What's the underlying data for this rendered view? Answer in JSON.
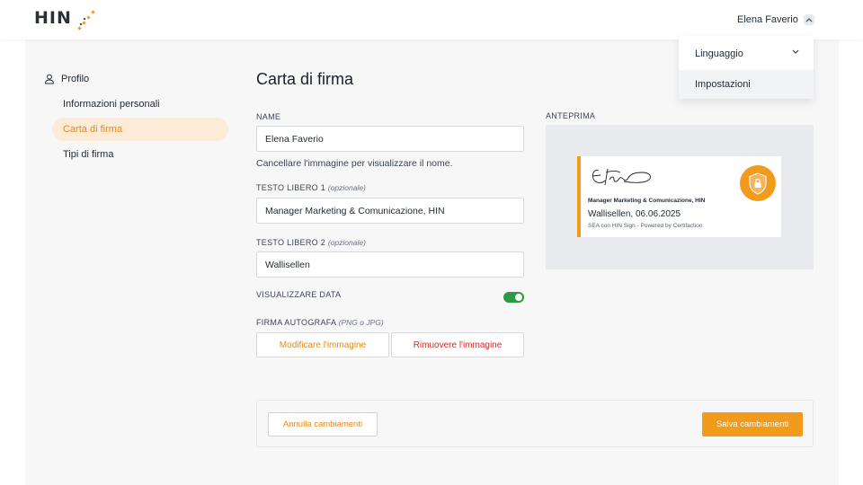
{
  "header": {
    "logo_text": "HIN",
    "user_name": "Elena Faverio"
  },
  "user_menu": {
    "items": [
      {
        "label": "Linguaggio"
      },
      {
        "label": "Impostazioni"
      }
    ]
  },
  "sidebar": {
    "section_title": "Profilo",
    "items": [
      {
        "label": "Informazioni personali",
        "active": false
      },
      {
        "label": "Carta di firma",
        "active": true
      },
      {
        "label": "Tipi di firma",
        "active": false
      }
    ]
  },
  "form": {
    "title": "Carta di firma",
    "name_label": "NAME",
    "name_value": "Elena Faverio",
    "name_hint": "Cancellare l'immagine per visualizzare il nome.",
    "free_text_1_label": "TESTO LIBERO 1",
    "free_text_1_optional": "(opzionale)",
    "free_text_1_value": "Manager Marketing & Comunicazione, HIN",
    "free_text_2_label": "TESTO LIBERO 2",
    "free_text_2_optional": "(opzionale)",
    "free_text_2_value": "Wallisellen",
    "show_date_label": "VISUALIZZARE DATA",
    "show_date_enabled": true,
    "autograph_label": "FIRMA AUTOGRAFA",
    "autograph_formats": "(PNG o JPG)",
    "modify_image_label": "Modificare l'immagine",
    "remove_image_label": "Rimuovere l'immagine"
  },
  "preview": {
    "label": "ANTEPRIMA",
    "line1": "Manager Marketing & Comunicazione, HIN",
    "line2": "Wallisellen, 06.06.2025",
    "line3": "SEA con HIN Sign - Powered by Certifaction"
  },
  "footer": {
    "cancel_label": "Annulla cambiamenti",
    "save_label": "Salva cambiamenti"
  },
  "colors": {
    "accent": "#f29a1b",
    "accent_text": "#e58a12",
    "active_bg": "#fdebd8",
    "toggle_on": "#2e9a45",
    "danger": "#d22a2a"
  }
}
